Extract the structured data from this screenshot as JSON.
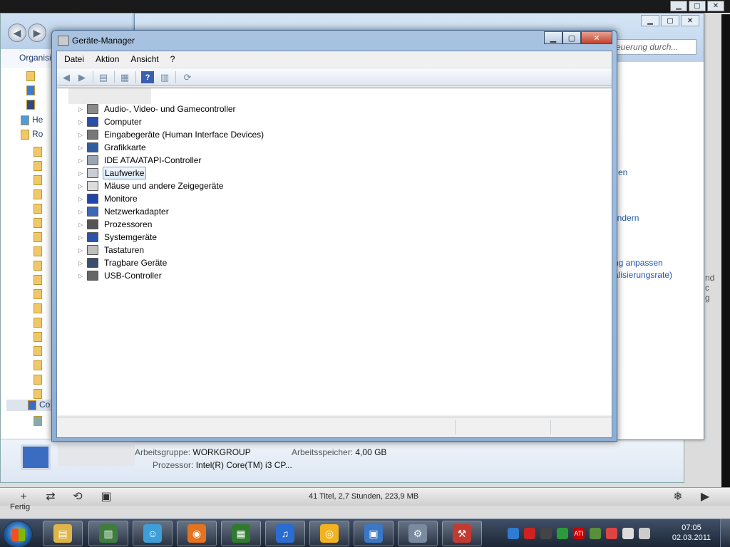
{
  "itunes": {
    "status_text": "41 Titel, 2,7 Stunden, 223,9 MB",
    "status_left": "Fertig",
    "add_glyph": "+",
    "shuffle_glyph": "⇄",
    "repeat_glyph": "⟲",
    "artwork_glyph": "▣",
    "visualizer_glyph": "❄",
    "mini_glyph": "▶"
  },
  "explorer": {
    "back_glyph": "◀",
    "fwd_glyph": "▶",
    "organize_label": "Organisi",
    "left_items": [
      "",
      "",
      "",
      "He",
      "Ro",
      "",
      "",
      "",
      "",
      "",
      "",
      "",
      "",
      "",
      "",
      "",
      "",
      "",
      "",
      "",
      "",
      "Co",
      "",
      ""
    ],
    "info": {
      "workgroup_label": "Arbeitsgruppe:",
      "workgroup_value": "WORKGROUP",
      "memory_label": "Arbeitsspeicher:",
      "memory_value": "4,00 GB",
      "processor_label": "Prozessor:",
      "processor_value": "Intel(R) Core(TM) i3 CP..."
    }
  },
  "display": {
    "search_placeholder": "euerung durch...",
    "links": [
      "en",
      "ändern",
      "ng anpassen",
      "alisierungsrate)"
    ],
    "right_side": [
      "nd",
      "c",
      "g"
    ]
  },
  "devmgr": {
    "title": "Geräte-Manager",
    "menu": [
      "Datei",
      "Aktion",
      "Ansicht",
      "?"
    ],
    "toolbar_icons": [
      "back-arrow-icon",
      "forward-arrow-icon",
      "show-hide-tree-icon",
      "properties-icon",
      "help-icon",
      "console-tree-icon",
      "scan-hardware-icon"
    ],
    "nodes": [
      {
        "label": "Audio-, Video- und Gamecontroller",
        "icon": "speaker-icon",
        "color": "#8a8a8a"
      },
      {
        "label": "Computer",
        "icon": "computer-icon",
        "color": "#2a4fa8"
      },
      {
        "label": "Eingabegeräte (Human Interface Devices)",
        "icon": "hid-icon",
        "color": "#777777"
      },
      {
        "label": "Grafikkarte",
        "icon": "display-adapter-icon",
        "color": "#2f5ea0"
      },
      {
        "label": "IDE ATA/ATAPI-Controller",
        "icon": "ide-controller-icon",
        "color": "#9aa6b4"
      },
      {
        "label": "Laufwerke",
        "icon": "disk-drive-icon",
        "color": "#c9ced6",
        "selected": true
      },
      {
        "label": "Mäuse und andere Zeigegeräte",
        "icon": "mouse-icon",
        "color": "#dcdcdc"
      },
      {
        "label": "Monitore",
        "icon": "monitor-icon",
        "color": "#2147a6"
      },
      {
        "label": "Netzwerkadapter",
        "icon": "network-adapter-icon",
        "color": "#3b68b8"
      },
      {
        "label": "Prozessoren",
        "icon": "processor-icon",
        "color": "#555555"
      },
      {
        "label": "Systemgeräte",
        "icon": "system-devices-icon",
        "color": "#2d54a9"
      },
      {
        "label": "Tastaturen",
        "icon": "keyboard-icon",
        "color": "#bfbfbf"
      },
      {
        "label": "Tragbare Geräte",
        "icon": "portable-device-icon",
        "color": "#3a4f70"
      },
      {
        "label": "USB-Controller",
        "icon": "usb-icon",
        "color": "#666666"
      }
    ]
  },
  "taskbar": {
    "apps": [
      {
        "name": "explorer-app",
        "glyph": "▤",
        "color": "#e0b548"
      },
      {
        "name": "task-monitor-app",
        "glyph": "▥",
        "color": "#3e7d3e"
      },
      {
        "name": "messenger-app",
        "glyph": "☺",
        "color": "#3e9fd8"
      },
      {
        "name": "firefox-app",
        "glyph": "◉",
        "color": "#e3731f"
      },
      {
        "name": "network-tool-app",
        "glyph": "▦",
        "color": "#2f7a2f"
      },
      {
        "name": "itunes-app",
        "glyph": "♫",
        "color": "#2a6ccf"
      },
      {
        "name": "media-app",
        "glyph": "◎",
        "color": "#f2b321"
      },
      {
        "name": "control-panel-app",
        "glyph": "▣",
        "color": "#3a78c6"
      },
      {
        "name": "device-manager-app",
        "glyph": "⚙",
        "color": "#7a8aa0"
      },
      {
        "name": "toolbox-app",
        "glyph": "⚒",
        "color": "#c23b32"
      }
    ],
    "tray": [
      {
        "name": "tray-sync-icon",
        "color": "#2e7bd1"
      },
      {
        "name": "tray-antivirus-icon",
        "color": "#c22"
      },
      {
        "name": "tray-network-icon",
        "color": "#444"
      },
      {
        "name": "tray-chrome-icon",
        "color": "#2c9a3b"
      },
      {
        "name": "tray-ati-icon",
        "color": "#c00",
        "text": "ATI"
      },
      {
        "name": "tray-safely-remove-icon",
        "color": "#5a8f3a"
      },
      {
        "name": "tray-action-center-flag-icon",
        "color": "#d44"
      },
      {
        "name": "tray-flag-icon",
        "color": "#ddd"
      },
      {
        "name": "tray-volume-icon",
        "color": "#ccc"
      }
    ],
    "time": "07:05",
    "date": "02.03.2011"
  }
}
